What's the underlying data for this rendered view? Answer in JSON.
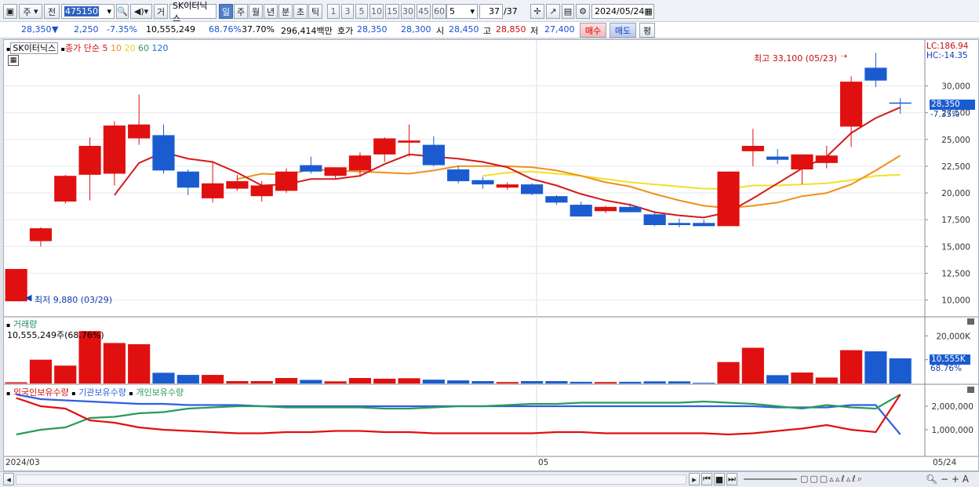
{
  "toolbar": {
    "market_type": "주",
    "prev_label": "전",
    "code": "475150",
    "trade_btn": "거",
    "stock_name": "SK이터닉스",
    "periods": [
      "일",
      "주",
      "월",
      "년",
      "분",
      "초",
      "틱"
    ],
    "active_period": "일",
    "intervals": [
      "1",
      "3",
      "5",
      "10",
      "15",
      "30",
      "45",
      "60"
    ],
    "interval_select": "5",
    "page": "37",
    "page_total": "/37",
    "date": "2024/05/24"
  },
  "quote": {
    "price": "28,350",
    "change": "2,250",
    "change_pct": "-7.35%",
    "volume": "10,555,249",
    "vol_ratio": "68.76%",
    "turnover": "37.70%",
    "amount": "296,414백만",
    "bid_label": "호가",
    "bid": "28,350",
    "ask": "28,300",
    "open_label": "시",
    "open": "28,450",
    "high_label": "고",
    "high": "28,850",
    "low_label": "저",
    "low": "27,400",
    "buy_btn": "매수",
    "sell_btn": "매도",
    "eval_btn": "평"
  },
  "legend": {
    "name": "SK이터닉스",
    "series": "종가 단순",
    "ma5": "5",
    "ma10": "10",
    "ma20": "20",
    "ma60": "60",
    "ma120": "120"
  },
  "annotations": {
    "high": "최고 33,100 (05/23)",
    "low": "최저 9,880 (03/29)",
    "lc": "LC:186.94",
    "hc": "HC:-14.35",
    "last_price": "28,350",
    "last_pct": "-7.35%",
    "vol_last": "10,555K",
    "vol_pct": "68.76%"
  },
  "volume_panel": {
    "title": "거래량",
    "value": "10,555,249주(68.76%)"
  },
  "holding_panel": {
    "series": [
      "외국인보유수량",
      "기관보유수량",
      "개인보유수량"
    ]
  },
  "x_labels": [
    "2024/03",
    "05",
    "05/24"
  ],
  "colors": {
    "up": "#e01010",
    "down": "#1a5cd0",
    "ma5": "#d41a1a",
    "ma10": "#f0901a",
    "ma20": "#f2e02a",
    "foreign": "#e01010",
    "inst": "#2f5fe0",
    "indiv": "#2a9a5a"
  },
  "chart_data": [
    {
      "type": "candlestick",
      "title": "SK이터닉스",
      "ylim": [
        8500,
        34000
      ],
      "yticks": [
        10000,
        12500,
        15000,
        17500,
        20000,
        22500,
        25000,
        27500,
        30000
      ],
      "candles": [
        {
          "o": 9880,
          "h": 12900,
          "l": 9880,
          "c": 12900
        },
        {
          "o": 15500,
          "h": 16800,
          "l": 15000,
          "c": 16700
        },
        {
          "o": 19200,
          "h": 21700,
          "l": 19000,
          "c": 21600
        },
        {
          "o": 21700,
          "h": 25200,
          "l": 19300,
          "c": 24400
        },
        {
          "o": 21800,
          "h": 26700,
          "l": 20700,
          "c": 26300
        },
        {
          "o": 25100,
          "h": 29200,
          "l": 24500,
          "c": 26400
        },
        {
          "o": 25400,
          "h": 26400,
          "l": 21800,
          "c": 22100
        },
        {
          "o": 22000,
          "h": 22200,
          "l": 19800,
          "c": 20500
        },
        {
          "o": 19500,
          "h": 23000,
          "l": 19100,
          "c": 20900
        },
        {
          "o": 20400,
          "h": 21700,
          "l": 20200,
          "c": 21100
        },
        {
          "o": 19700,
          "h": 21100,
          "l": 19200,
          "c": 20700
        },
        {
          "o": 20200,
          "h": 22300,
          "l": 20000,
          "c": 22000
        },
        {
          "o": 22600,
          "h": 23400,
          "l": 21800,
          "c": 22000
        },
        {
          "o": 21600,
          "h": 22400,
          "l": 21300,
          "c": 22400
        },
        {
          "o": 22100,
          "h": 23800,
          "l": 21500,
          "c": 23500
        },
        {
          "o": 23600,
          "h": 25200,
          "l": 22900,
          "c": 25100
        },
        {
          "o": 24700,
          "h": 26400,
          "l": 23400,
          "c": 24900
        },
        {
          "o": 24500,
          "h": 25300,
          "l": 22500,
          "c": 22600
        },
        {
          "o": 22200,
          "h": 22500,
          "l": 20900,
          "c": 21100
        },
        {
          "o": 21200,
          "h": 21500,
          "l": 20400,
          "c": 20800
        },
        {
          "o": 20500,
          "h": 21000,
          "l": 20300,
          "c": 20800
        },
        {
          "o": 20800,
          "h": 20900,
          "l": 19800,
          "c": 19900
        },
        {
          "o": 19700,
          "h": 19800,
          "l": 18900,
          "c": 19100
        },
        {
          "o": 18900,
          "h": 19200,
          "l": 17800,
          "c": 17800
        },
        {
          "o": 18300,
          "h": 18800,
          "l": 18100,
          "c": 18700
        },
        {
          "o": 18700,
          "h": 19000,
          "l": 18200,
          "c": 18200
        },
        {
          "o": 18000,
          "h": 18300,
          "l": 16900,
          "c": 17000
        },
        {
          "o": 17200,
          "h": 17600,
          "l": 16800,
          "c": 17000
        },
        {
          "o": 17200,
          "h": 17500,
          "l": 16900,
          "c": 16900
        },
        {
          "o": 16900,
          "h": 22000,
          "l": 16900,
          "c": 22000
        },
        {
          "o": 23900,
          "h": 26000,
          "l": 22500,
          "c": 24400
        },
        {
          "o": 23400,
          "h": 24100,
          "l": 22700,
          "c": 23100
        },
        {
          "o": 22200,
          "h": 23600,
          "l": 20800,
          "c": 23600
        },
        {
          "o": 22800,
          "h": 24400,
          "l": 22300,
          "c": 23500
        },
        {
          "o": 26200,
          "h": 30900,
          "l": 24300,
          "c": 30400
        },
        {
          "o": 31700,
          "h": 33100,
          "l": 29900,
          "c": 30500
        },
        {
          "o": 28450,
          "h": 28850,
          "l": 27400,
          "c": 28350
        }
      ],
      "ma5": [
        null,
        null,
        null,
        null,
        19800,
        22800,
        23800,
        23200,
        22900,
        21900,
        20700,
        20800,
        21300,
        21300,
        21600,
        22700,
        23600,
        23400,
        23200,
        22900,
        22400,
        21300,
        20700,
        19900,
        19300,
        18900,
        18200,
        17900,
        17700,
        18200,
        19500,
        20900,
        22300,
        23400,
        25600,
        27000,
        28000
      ],
      "ma10": [
        null,
        null,
        null,
        null,
        null,
        null,
        null,
        null,
        null,
        21300,
        21800,
        21700,
        22200,
        22100,
        22000,
        21900,
        21800,
        22100,
        22500,
        22500,
        22500,
        22400,
        22100,
        21600,
        21000,
        20600,
        19900,
        19300,
        18800,
        18600,
        18800,
        19100,
        19700,
        20000,
        20800,
        22100,
        23500
      ],
      "ma20": [
        null,
        null,
        null,
        null,
        null,
        null,
        null,
        null,
        null,
        null,
        null,
        null,
        null,
        null,
        null,
        null,
        null,
        null,
        null,
        21600,
        21900,
        22000,
        21800,
        21600,
        21300,
        21000,
        20800,
        20600,
        20400,
        20400,
        20700,
        20700,
        20800,
        20900,
        21200,
        21600,
        21700
      ]
    },
    {
      "type": "bar",
      "title": "거래량",
      "ylim": [
        0,
        28000
      ],
      "unit": "K",
      "values": [
        500,
        10000,
        7500,
        22000,
        17000,
        16500,
        4500,
        3600,
        3600,
        1000,
        1000,
        2300,
        1500,
        900,
        2300,
        2000,
        2200,
        1600,
        1300,
        1000,
        600,
        1000,
        1000,
        700,
        600,
        700,
        900,
        900,
        300,
        9000,
        15000,
        3500,
        4600,
        2500,
        14000,
        13500,
        10555
      ]
    },
    {
      "type": "line",
      "title": "외국인보유수량 / 기관보유수량 / 개인보유수량",
      "ylim": [
        0,
        2800000
      ],
      "series": [
        {
          "name": "외국인보유수량",
          "values": [
            2350000,
            2000000,
            1900000,
            1400000,
            1300000,
            1100000,
            1000000,
            950000,
            900000,
            850000,
            850000,
            900000,
            900000,
            950000,
            950000,
            900000,
            900000,
            850000,
            850000,
            850000,
            850000,
            850000,
            900000,
            900000,
            850000,
            850000,
            850000,
            850000,
            850000,
            800000,
            850000,
            950000,
            1050000,
            1200000,
            1000000,
            900000,
            2500000
          ]
        },
        {
          "name": "기관보유수량",
          "values": [
            2500000,
            2300000,
            2250000,
            2200000,
            2150000,
            2100000,
            2100000,
            2050000,
            2050000,
            2050000,
            2000000,
            2000000,
            2000000,
            2000000,
            2000000,
            2000000,
            2000000,
            2000000,
            2000000,
            2000000,
            2000000,
            2000000,
            2000000,
            2000000,
            2000000,
            2000000,
            2000000,
            2000000,
            2000000,
            2000000,
            2000000,
            1950000,
            1950000,
            1950000,
            2050000,
            2050000,
            800000
          ]
        },
        {
          "name": "개인보유수량",
          "values": [
            800000,
            1000000,
            1100000,
            1500000,
            1550000,
            1700000,
            1750000,
            1900000,
            1950000,
            2000000,
            2000000,
            1950000,
            1950000,
            1950000,
            1950000,
            1900000,
            1900000,
            1950000,
            2000000,
            2000000,
            2050000,
            2100000,
            2100000,
            2150000,
            2150000,
            2150000,
            2150000,
            2150000,
            2200000,
            2150000,
            2100000,
            2000000,
            1900000,
            2050000,
            1950000,
            1900000,
            2500000
          ]
        }
      ]
    }
  ]
}
